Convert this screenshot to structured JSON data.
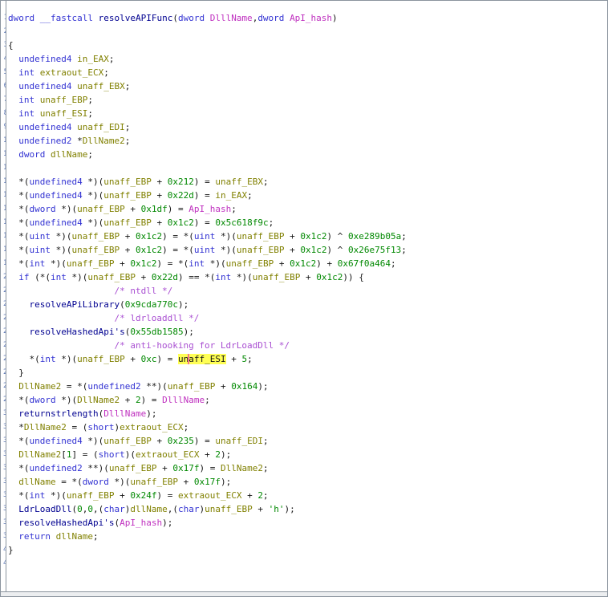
{
  "view": "decompiler-code-listing",
  "colors": {
    "keyword": "#3232d2",
    "function_name": "#000090",
    "local_variable": "#808000",
    "parameter": "#bf30bf",
    "constant": "#008800",
    "comment": "#a94fd2",
    "punctuation": "#141414",
    "highlight_background": "#ffff55",
    "caret": "#f4758f",
    "line_number": "#5b76b5",
    "border": "#8b949e",
    "scrollbar_track": "#eceef0",
    "background": "#ffffff"
  },
  "gutter": {
    "visible_line_count": 41
  },
  "highlight": {
    "token": "unaff_ESI",
    "caret_after": "un"
  },
  "code": {
    "lines": [
      [
        [
          "kw",
          "dword "
        ],
        [
          "kw",
          "__fastcall "
        ],
        [
          "fn",
          "resolveAPIFunc"
        ],
        [
          "op",
          "("
        ],
        [
          "kw",
          "dword "
        ],
        [
          "param",
          "DlllName"
        ],
        [
          "op",
          ","
        ],
        [
          "kw",
          "dword "
        ],
        [
          "param",
          "ApI_hash"
        ],
        [
          "op",
          ")"
        ]
      ],
      [],
      [
        [
          "op",
          "{"
        ]
      ],
      [
        [
          "kw",
          "  undefined4 "
        ],
        [
          "var",
          "in_EAX"
        ],
        [
          "op",
          ";"
        ]
      ],
      [
        [
          "kw",
          "  int "
        ],
        [
          "var",
          "extraout_ECX"
        ],
        [
          "op",
          ";"
        ]
      ],
      [
        [
          "kw",
          "  undefined4 "
        ],
        [
          "var",
          "unaff_EBX"
        ],
        [
          "op",
          ";"
        ]
      ],
      [
        [
          "kw",
          "  int "
        ],
        [
          "var",
          "unaff_EBP"
        ],
        [
          "op",
          ";"
        ]
      ],
      [
        [
          "kw",
          "  int "
        ],
        [
          "var",
          "unaff_ESI"
        ],
        [
          "op",
          ";"
        ]
      ],
      [
        [
          "kw",
          "  undefined4 "
        ],
        [
          "var",
          "unaff_EDI"
        ],
        [
          "op",
          ";"
        ]
      ],
      [
        [
          "kw",
          "  undefined2 "
        ],
        [
          "op",
          "*"
        ],
        [
          "var",
          "DllName2"
        ],
        [
          "op",
          ";"
        ]
      ],
      [
        [
          "kw",
          "  dword "
        ],
        [
          "var",
          "dllName"
        ],
        [
          "op",
          ";"
        ]
      ],
      [],
      [
        [
          "op",
          "  *("
        ],
        [
          "kw",
          "undefined4"
        ],
        [
          "op",
          " *)("
        ],
        [
          "var",
          "unaff_EBP"
        ],
        [
          "op",
          " + "
        ],
        [
          "const",
          "0x212"
        ],
        [
          "op",
          ") = "
        ],
        [
          "var",
          "unaff_EBX"
        ],
        [
          "op",
          ";"
        ]
      ],
      [
        [
          "op",
          "  *("
        ],
        [
          "kw",
          "undefined4"
        ],
        [
          "op",
          " *)("
        ],
        [
          "var",
          "unaff_EBP"
        ],
        [
          "op",
          " + "
        ],
        [
          "const",
          "0x22d"
        ],
        [
          "op",
          ") = "
        ],
        [
          "var",
          "in_EAX"
        ],
        [
          "op",
          ";"
        ]
      ],
      [
        [
          "op",
          "  *("
        ],
        [
          "kw",
          "dword"
        ],
        [
          "op",
          " *)("
        ],
        [
          "var",
          "unaff_EBP"
        ],
        [
          "op",
          " + "
        ],
        [
          "const",
          "0x1df"
        ],
        [
          "op",
          ") = "
        ],
        [
          "param",
          "ApI_hash"
        ],
        [
          "op",
          ";"
        ]
      ],
      [
        [
          "op",
          "  *("
        ],
        [
          "kw",
          "undefined4"
        ],
        [
          "op",
          " *)("
        ],
        [
          "var",
          "unaff_EBP"
        ],
        [
          "op",
          " + "
        ],
        [
          "const",
          "0x1c2"
        ],
        [
          "op",
          ") = "
        ],
        [
          "const",
          "0x5c618f9c"
        ],
        [
          "op",
          ";"
        ]
      ],
      [
        [
          "op",
          "  *("
        ],
        [
          "kw",
          "uint"
        ],
        [
          "op",
          " *)("
        ],
        [
          "var",
          "unaff_EBP"
        ],
        [
          "op",
          " + "
        ],
        [
          "const",
          "0x1c2"
        ],
        [
          "op",
          ") = *("
        ],
        [
          "kw",
          "uint"
        ],
        [
          "op",
          " *)("
        ],
        [
          "var",
          "unaff_EBP"
        ],
        [
          "op",
          " + "
        ],
        [
          "const",
          "0x1c2"
        ],
        [
          "op",
          ") ^ "
        ],
        [
          "const",
          "0xe289b05a"
        ],
        [
          "op",
          ";"
        ]
      ],
      [
        [
          "op",
          "  *("
        ],
        [
          "kw",
          "uint"
        ],
        [
          "op",
          " *)("
        ],
        [
          "var",
          "unaff_EBP"
        ],
        [
          "op",
          " + "
        ],
        [
          "const",
          "0x1c2"
        ],
        [
          "op",
          ") = *("
        ],
        [
          "kw",
          "uint"
        ],
        [
          "op",
          " *)("
        ],
        [
          "var",
          "unaff_EBP"
        ],
        [
          "op",
          " + "
        ],
        [
          "const",
          "0x1c2"
        ],
        [
          "op",
          ") ^ "
        ],
        [
          "const",
          "0x26e75f13"
        ],
        [
          "op",
          ";"
        ]
      ],
      [
        [
          "op",
          "  *("
        ],
        [
          "kw",
          "int"
        ],
        [
          "op",
          " *)("
        ],
        [
          "var",
          "unaff_EBP"
        ],
        [
          "op",
          " + "
        ],
        [
          "const",
          "0x1c2"
        ],
        [
          "op",
          ") = *("
        ],
        [
          "kw",
          "int"
        ],
        [
          "op",
          " *)("
        ],
        [
          "var",
          "unaff_EBP"
        ],
        [
          "op",
          " + "
        ],
        [
          "const",
          "0x1c2"
        ],
        [
          "op",
          ") + "
        ],
        [
          "const",
          "0x67f0a464"
        ],
        [
          "op",
          ";"
        ]
      ],
      [
        [
          "kw",
          "  if "
        ],
        [
          "op",
          "(*("
        ],
        [
          "kw",
          "int"
        ],
        [
          "op",
          " *)("
        ],
        [
          "var",
          "unaff_EBP"
        ],
        [
          "op",
          " + "
        ],
        [
          "const",
          "0x22d"
        ],
        [
          "op",
          ") == *("
        ],
        [
          "kw",
          "int"
        ],
        [
          "op",
          " *)("
        ],
        [
          "var",
          "unaff_EBP"
        ],
        [
          "op",
          " + "
        ],
        [
          "const",
          "0x1c2"
        ],
        [
          "op",
          ")) {"
        ]
      ],
      [
        [
          "com",
          "                    /* ntdll */"
        ]
      ],
      [
        [
          "op",
          "    "
        ],
        [
          "fn",
          "resolveAPiLibrary"
        ],
        [
          "op",
          "("
        ],
        [
          "const",
          "0x9cda770c"
        ],
        [
          "op",
          ");"
        ]
      ],
      [
        [
          "com",
          "                    /* ldrloaddll */"
        ]
      ],
      [
        [
          "op",
          "    "
        ],
        [
          "fn",
          "resolveHashedApi's"
        ],
        [
          "op",
          "("
        ],
        [
          "const",
          "0x55db1585"
        ],
        [
          "op",
          ");"
        ]
      ],
      [
        [
          "com",
          "                    /* anti-hooking for LdrLoadDll */"
        ]
      ],
      [
        [
          "op",
          "    *("
        ],
        [
          "kw",
          "int"
        ],
        [
          "op",
          " *)("
        ],
        [
          "var",
          "unaff_EBP"
        ],
        [
          "op",
          " + "
        ],
        [
          "const",
          "0xc"
        ],
        [
          "op",
          ") = "
        ],
        [
          "hl",
          "un"
        ],
        [
          "caret",
          ""
        ],
        [
          "hl",
          "aff_ESI"
        ],
        [
          "op",
          " + "
        ],
        [
          "const",
          "5"
        ],
        [
          "op",
          ";"
        ]
      ],
      [
        [
          "op",
          "  }"
        ]
      ],
      [
        [
          "op",
          "  "
        ],
        [
          "var",
          "DllName2"
        ],
        [
          "op",
          " = *("
        ],
        [
          "kw",
          "undefined2"
        ],
        [
          "op",
          " **)("
        ],
        [
          "var",
          "unaff_EBP"
        ],
        [
          "op",
          " + "
        ],
        [
          "const",
          "0x164"
        ],
        [
          "op",
          ");"
        ]
      ],
      [
        [
          "op",
          "  *("
        ],
        [
          "kw",
          "dword"
        ],
        [
          "op",
          " *)("
        ],
        [
          "var",
          "DllName2"
        ],
        [
          "op",
          " + "
        ],
        [
          "const",
          "2"
        ],
        [
          "op",
          ") = "
        ],
        [
          "param",
          "DlllName"
        ],
        [
          "op",
          ";"
        ]
      ],
      [
        [
          "op",
          "  "
        ],
        [
          "fn",
          "returnstrlength"
        ],
        [
          "op",
          "("
        ],
        [
          "param",
          "DlllName"
        ],
        [
          "op",
          ");"
        ]
      ],
      [
        [
          "op",
          "  *"
        ],
        [
          "var",
          "DllName2"
        ],
        [
          "op",
          " = ("
        ],
        [
          "kw",
          "short"
        ],
        [
          "op",
          ")"
        ],
        [
          "var",
          "extraout_ECX"
        ],
        [
          "op",
          ";"
        ]
      ],
      [
        [
          "op",
          "  *("
        ],
        [
          "kw",
          "undefined4"
        ],
        [
          "op",
          " *)("
        ],
        [
          "var",
          "unaff_EBP"
        ],
        [
          "op",
          " + "
        ],
        [
          "const",
          "0x235"
        ],
        [
          "op",
          ") = "
        ],
        [
          "var",
          "unaff_EDI"
        ],
        [
          "op",
          ";"
        ]
      ],
      [
        [
          "op",
          "  "
        ],
        [
          "var",
          "DllName2"
        ],
        [
          "op",
          "["
        ],
        [
          "const",
          "1"
        ],
        [
          "op",
          "] = ("
        ],
        [
          "kw",
          "short"
        ],
        [
          "op",
          ")("
        ],
        [
          "var",
          "extraout_ECX"
        ],
        [
          "op",
          " + "
        ],
        [
          "const",
          "2"
        ],
        [
          "op",
          ");"
        ]
      ],
      [
        [
          "op",
          "  *("
        ],
        [
          "kw",
          "undefined2"
        ],
        [
          "op",
          " **)("
        ],
        [
          "var",
          "unaff_EBP"
        ],
        [
          "op",
          " + "
        ],
        [
          "const",
          "0x17f"
        ],
        [
          "op",
          ") = "
        ],
        [
          "var",
          "DllName2"
        ],
        [
          "op",
          ";"
        ]
      ],
      [
        [
          "op",
          "  "
        ],
        [
          "var",
          "dllName"
        ],
        [
          "op",
          " = *("
        ],
        [
          "kw",
          "dword"
        ],
        [
          "op",
          " *)("
        ],
        [
          "var",
          "unaff_EBP"
        ],
        [
          "op",
          " + "
        ],
        [
          "const",
          "0x17f"
        ],
        [
          "op",
          ");"
        ]
      ],
      [
        [
          "op",
          "  *("
        ],
        [
          "kw",
          "int"
        ],
        [
          "op",
          " *)("
        ],
        [
          "var",
          "unaff_EBP"
        ],
        [
          "op",
          " + "
        ],
        [
          "const",
          "0x24f"
        ],
        [
          "op",
          ") = "
        ],
        [
          "var",
          "extraout_ECX"
        ],
        [
          "op",
          " + "
        ],
        [
          "const",
          "2"
        ],
        [
          "op",
          ";"
        ]
      ],
      [
        [
          "op",
          "  "
        ],
        [
          "fn",
          "LdrLoadDll"
        ],
        [
          "op",
          "("
        ],
        [
          "const",
          "0"
        ],
        [
          "op",
          ","
        ],
        [
          "const",
          "0"
        ],
        [
          "op",
          ",("
        ],
        [
          "kw",
          "char"
        ],
        [
          "op",
          ")"
        ],
        [
          "var",
          "dllName"
        ],
        [
          "op",
          ",("
        ],
        [
          "kw",
          "char"
        ],
        [
          "op",
          ")"
        ],
        [
          "var",
          "unaff_EBP"
        ],
        [
          "op",
          " + "
        ],
        [
          "const",
          "'h'"
        ],
        [
          "op",
          ");"
        ]
      ],
      [
        [
          "op",
          "  "
        ],
        [
          "fn",
          "resolveHashedApi's"
        ],
        [
          "op",
          "("
        ],
        [
          "param",
          "ApI_hash"
        ],
        [
          "op",
          ");"
        ]
      ],
      [
        [
          "kw",
          "  return "
        ],
        [
          "var",
          "dllName"
        ],
        [
          "op",
          ";"
        ]
      ],
      [
        [
          "op",
          "}"
        ]
      ]
    ]
  }
}
